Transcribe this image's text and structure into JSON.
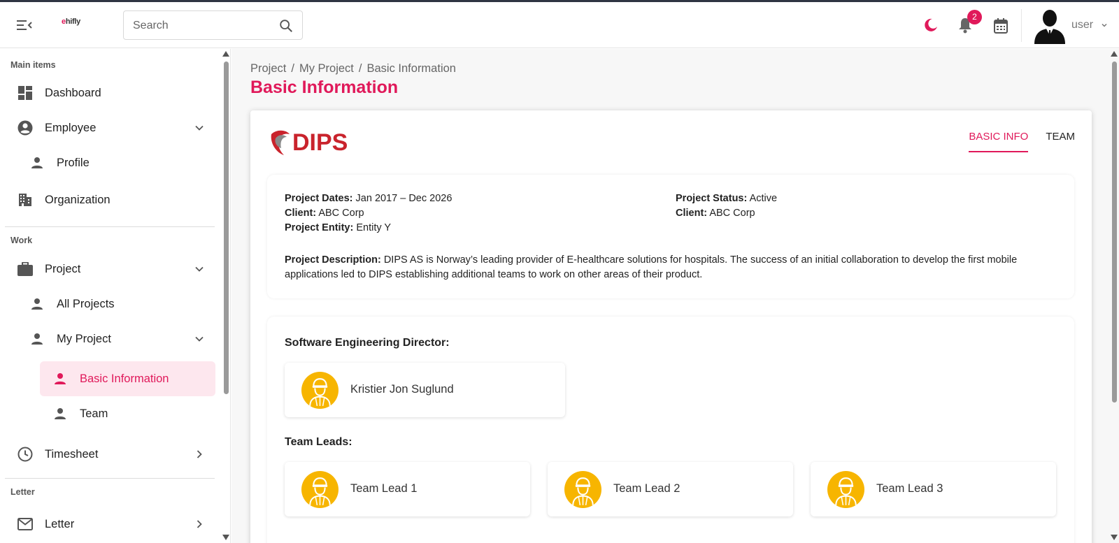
{
  "header": {
    "brand": "hifly",
    "brand_mark": "e",
    "search_placeholder": "Search",
    "notification_count": "2",
    "user_name": "user"
  },
  "sidebar": {
    "sections": [
      {
        "label": "Main items"
      },
      {
        "label": "Work"
      },
      {
        "label": "Letter"
      }
    ],
    "items": {
      "dashboard": "Dashboard",
      "employee": "Employee",
      "profile": "Profile",
      "organization": "Organization",
      "project": "Project",
      "all_projects": "All Projects",
      "my_project": "My Project",
      "basic_information": "Basic Information",
      "team": "Team",
      "timesheet": "Timesheet",
      "letter": "Letter"
    }
  },
  "main": {
    "breadcrumb": [
      "Project",
      "My Project",
      "Basic Information"
    ],
    "breadcrumb_sep": "/",
    "title": "Basic Information",
    "company_logo_text": "DIPS",
    "tabs": [
      {
        "label": "BASIC INFO",
        "active": true
      },
      {
        "label": "TEAM",
        "active": false
      }
    ],
    "info": {
      "dates_label": "Project Dates:",
      "dates_value": "Jan 2017 – Dec 2026",
      "client_label": "Client:",
      "client_value": "ABC Corp",
      "entity_label": "Project Entity:",
      "entity_value": "Entity Y",
      "status_label": "Project Status:",
      "status_value": "Active",
      "client2_label": "Client:",
      "client2_value": "ABC Corp",
      "desc_label": "Project Description:",
      "desc_value": "DIPS AS is Norway’s leading provider of E-healthcare solutions for hospitals. The success of an initial collaboration to develop the first mobile applications led to DIPS establishing additional teams to work on other areas of their product."
    },
    "director_title": "Software Engineering Director:",
    "director_name": "Kristier Jon Suglund",
    "leads_title": "Team Leads:",
    "leads": [
      "Team Lead 1",
      "Team Lead 2",
      "Team Lead 3"
    ]
  },
  "colors": {
    "accent": "#e0195a",
    "avatar_bg": "#f7b500",
    "active_bg": "#fde7ee"
  }
}
